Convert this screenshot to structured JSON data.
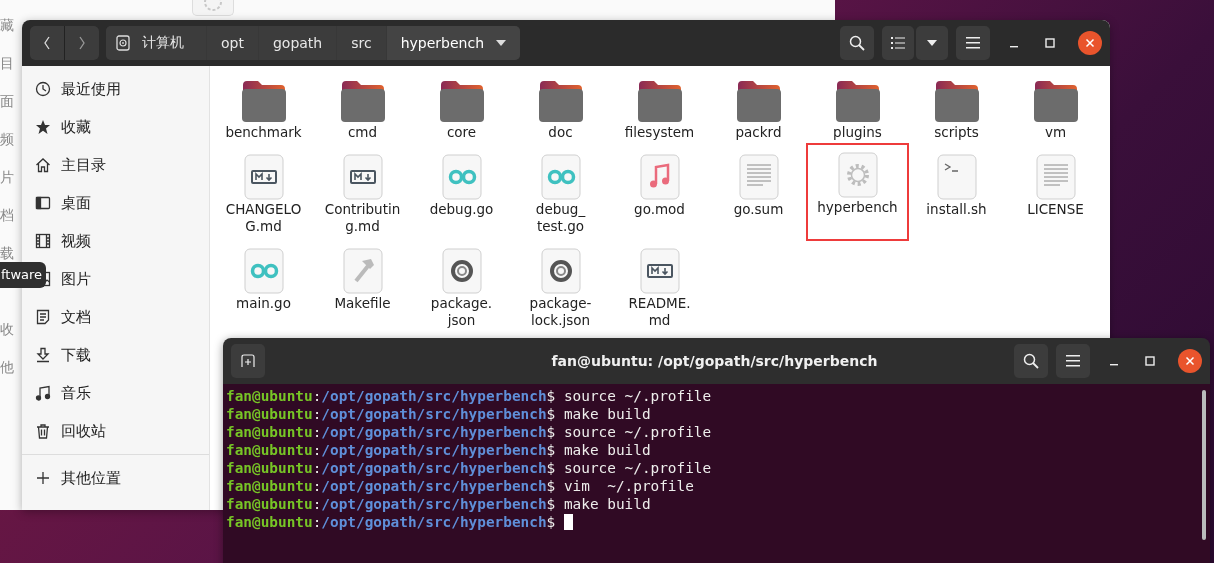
{
  "background_window": {
    "sidebar_items": [
      "藏",
      "目",
      "面",
      "频",
      "片",
      "档",
      "载",
      "收",
      "他"
    ]
  },
  "tooltip": {
    "text": "ftware"
  },
  "files_window": {
    "path": [
      {
        "label": "计算机",
        "kind": "root",
        "selected": false
      },
      {
        "label": "opt",
        "kind": "dir",
        "selected": false
      },
      {
        "label": "gopath",
        "kind": "dir",
        "selected": false
      },
      {
        "label": "src",
        "kind": "dir",
        "selected": false
      },
      {
        "label": "hyperbench",
        "kind": "dir",
        "selected": true
      }
    ],
    "sidebar": [
      {
        "label": "最近使用",
        "kind": "clock"
      },
      {
        "label": "收藏",
        "kind": "star"
      },
      {
        "label": "主目录",
        "kind": "home"
      },
      {
        "label": "桌面",
        "kind": "desktop"
      },
      {
        "label": "视频",
        "kind": "film"
      },
      {
        "label": "图片",
        "kind": "image"
      },
      {
        "label": "文档",
        "kind": "document"
      },
      {
        "label": "下载",
        "kind": "download"
      },
      {
        "label": "音乐",
        "kind": "music"
      },
      {
        "label": "回收站",
        "kind": "trash"
      },
      {
        "label": "其他位置",
        "kind": "plus"
      }
    ],
    "files": [
      {
        "label_lines": [
          "benchmark"
        ],
        "kind": "folder",
        "highlighted": false
      },
      {
        "label_lines": [
          "cmd"
        ],
        "kind": "folder",
        "highlighted": false
      },
      {
        "label_lines": [
          "core"
        ],
        "kind": "folder",
        "highlighted": false
      },
      {
        "label_lines": [
          "doc"
        ],
        "kind": "folder",
        "highlighted": false
      },
      {
        "label_lines": [
          "filesystem"
        ],
        "kind": "folder",
        "highlighted": false
      },
      {
        "label_lines": [
          "packrd"
        ],
        "kind": "folder",
        "highlighted": false
      },
      {
        "label_lines": [
          "plugins"
        ],
        "kind": "folder",
        "highlighted": false
      },
      {
        "label_lines": [
          "scripts"
        ],
        "kind": "folder",
        "highlighted": false
      },
      {
        "label_lines": [
          "vm"
        ],
        "kind": "folder",
        "highlighted": false
      },
      {
        "label_lines": [
          "CHANGELO",
          "G.md"
        ],
        "kind": "markdown",
        "highlighted": false
      },
      {
        "label_lines": [
          "Contributin",
          "g.md"
        ],
        "kind": "markdown",
        "highlighted": false
      },
      {
        "label_lines": [
          "debug.go"
        ],
        "kind": "go",
        "highlighted": false
      },
      {
        "label_lines": [
          "debug_",
          "test.go"
        ],
        "kind": "go",
        "highlighted": false
      },
      {
        "label_lines": [
          "go.mod"
        ],
        "kind": "audio",
        "highlighted": false
      },
      {
        "label_lines": [
          "go.sum"
        ],
        "kind": "text",
        "highlighted": false
      },
      {
        "label_lines": [
          "hyperbench"
        ],
        "kind": "executable",
        "highlighted": true
      },
      {
        "label_lines": [
          "install.sh"
        ],
        "kind": "script",
        "highlighted": false
      },
      {
        "label_lines": [
          "LICENSE"
        ],
        "kind": "text",
        "highlighted": false
      },
      {
        "label_lines": [
          "main.go"
        ],
        "kind": "go",
        "highlighted": false
      },
      {
        "label_lines": [
          "Makefile"
        ],
        "kind": "makefile",
        "highlighted": false
      },
      {
        "label_lines": [
          "package.",
          "json"
        ],
        "kind": "json",
        "highlighted": false
      },
      {
        "label_lines": [
          "package-",
          "lock.json"
        ],
        "kind": "json",
        "highlighted": false
      },
      {
        "label_lines": [
          "README.",
          "md"
        ],
        "kind": "markdown",
        "highlighted": false
      }
    ]
  },
  "terminal": {
    "title": "fan@ubuntu: /opt/gopath/src/hyperbench",
    "lines": [
      {
        "user": "fan@ubuntu",
        "sep": ":",
        "path": "/opt/gopath/src/hyperbench",
        "sigil": "$",
        "command": "source ~/.profile",
        "cursor": false
      },
      {
        "user": "fan@ubuntu",
        "sep": ":",
        "path": "/opt/gopath/src/hyperbench",
        "sigil": "$",
        "command": "make build",
        "cursor": false
      },
      {
        "user": "fan@ubuntu",
        "sep": ":",
        "path": "/opt/gopath/src/hyperbench",
        "sigil": "$",
        "command": "source ~/.profile",
        "cursor": false
      },
      {
        "user": "fan@ubuntu",
        "sep": ":",
        "path": "/opt/gopath/src/hyperbench",
        "sigil": "$",
        "command": "make build",
        "cursor": false
      },
      {
        "user": "fan@ubuntu",
        "sep": ":",
        "path": "/opt/gopath/src/hyperbench",
        "sigil": "$",
        "command": "source ~/.profile",
        "cursor": false
      },
      {
        "user": "fan@ubuntu",
        "sep": ":",
        "path": "/opt/gopath/src/hyperbench",
        "sigil": "$",
        "command": "vim  ~/.profile",
        "cursor": false
      },
      {
        "user": "fan@ubuntu",
        "sep": ":",
        "path": "/opt/gopath/src/hyperbench",
        "sigil": "$",
        "command": "make build",
        "cursor": false
      },
      {
        "user": "fan@ubuntu",
        "sep": ":",
        "path": "/opt/gopath/src/hyperbench",
        "sigil": "$",
        "cursor": true
      }
    ]
  }
}
